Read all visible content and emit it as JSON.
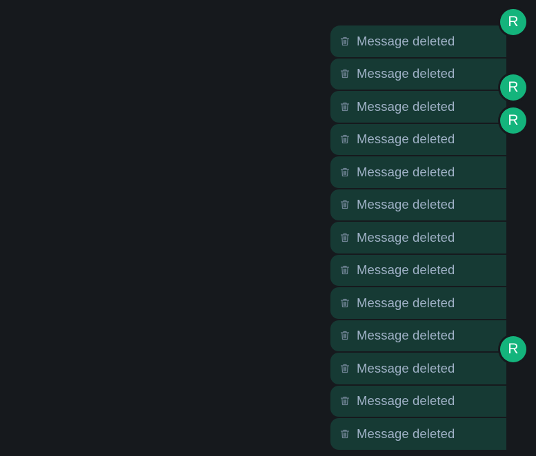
{
  "colors": {
    "background": "#16191d",
    "bubble": "#163a34",
    "bubble_text": "#9fb1c6",
    "icon": "#6f8394",
    "avatar": "#14b47c"
  },
  "messages": [
    {
      "text": "Message deleted",
      "icon": "trash-icon"
    },
    {
      "text": "Message deleted",
      "icon": "trash-icon"
    },
    {
      "text": "Message deleted",
      "icon": "trash-icon"
    },
    {
      "text": "Message deleted",
      "icon": "trash-icon"
    },
    {
      "text": "Message deleted",
      "icon": "trash-icon"
    },
    {
      "text": "Message deleted",
      "icon": "trash-icon"
    },
    {
      "text": "Message deleted",
      "icon": "trash-icon"
    },
    {
      "text": "Message deleted",
      "icon": "trash-icon"
    },
    {
      "text": "Message deleted",
      "icon": "trash-icon"
    },
    {
      "text": "Message deleted",
      "icon": "trash-icon"
    },
    {
      "text": "Message deleted",
      "icon": "trash-icon"
    },
    {
      "text": "Message deleted",
      "icon": "trash-icon"
    },
    {
      "text": "Message deleted",
      "icon": "trash-icon"
    }
  ],
  "avatars": [
    {
      "initial": "R"
    },
    {
      "initial": "R"
    },
    {
      "initial": "R"
    },
    {
      "initial": "R"
    }
  ]
}
